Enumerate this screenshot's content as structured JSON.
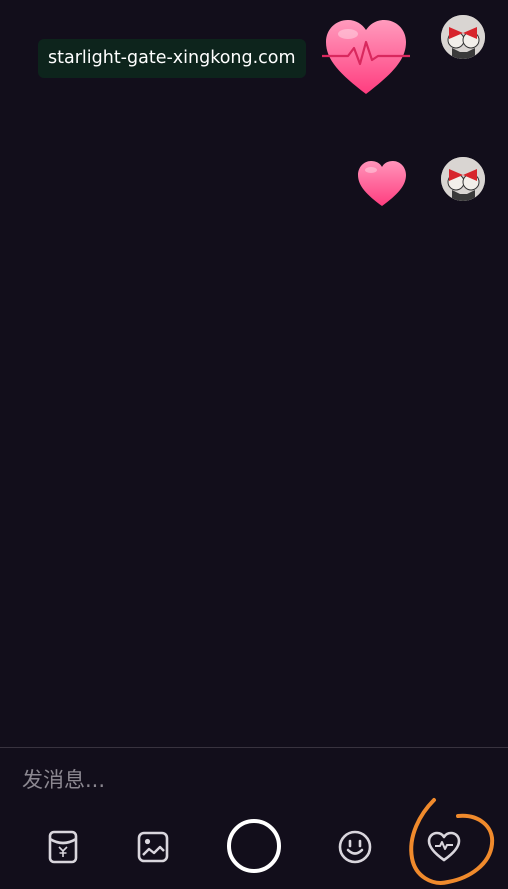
{
  "overlay": {
    "url_text": "starlight-gate-xingkong.com"
  },
  "messages": [
    {
      "sender": "self",
      "content_type": "heartbeat-heart-sticker"
    },
    {
      "sender": "self",
      "content_type": "heart-sticker"
    }
  ],
  "composer": {
    "placeholder": "发消息..."
  },
  "toolbar": {
    "buttons": [
      {
        "name": "red-packet-icon"
      },
      {
        "name": "image-icon"
      },
      {
        "name": "record-button"
      },
      {
        "name": "emoji-icon"
      },
      {
        "name": "heartbeat-icon"
      }
    ]
  },
  "colors": {
    "background": "#120e1b",
    "heart_pink": "#ff4f8b",
    "heart_light": "#ff8ab1",
    "highlight_orange": "#f08a2c",
    "badge_bg": "#0d241c",
    "divider": "#38333f"
  }
}
